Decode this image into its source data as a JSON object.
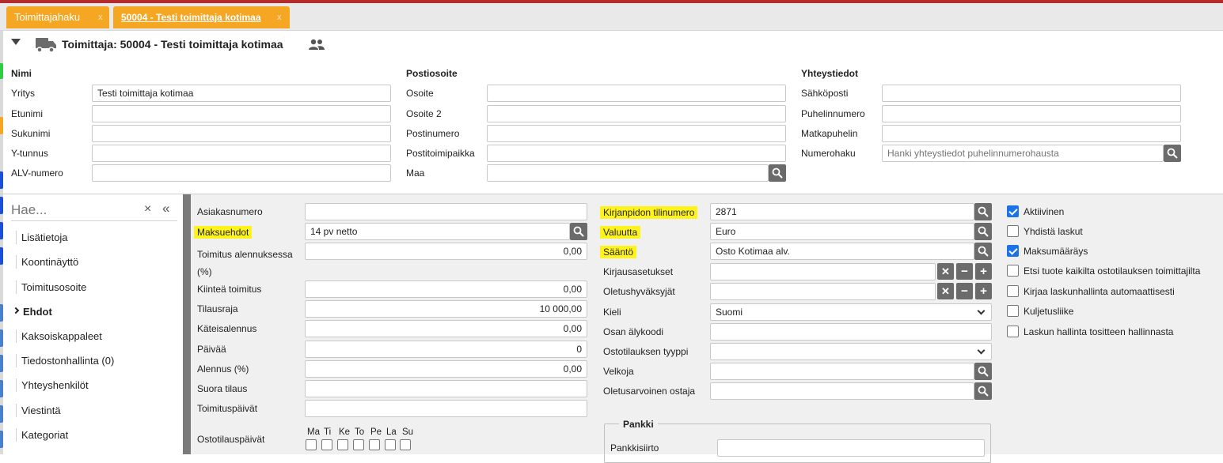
{
  "tabs": [
    {
      "label": "Toimittajahaku",
      "close": "x"
    },
    {
      "label": "50004 - Testi toimittaja kotimaa",
      "close": "x"
    }
  ],
  "header": {
    "title": "Toimittaja: 50004 - Testi toimittaja kotimaa",
    "icons": [
      "collapse-triangle-icon",
      "truck-icon",
      "people-icon"
    ]
  },
  "nimi": {
    "heading": "Nimi",
    "fields": [
      {
        "label": "Yritys",
        "value": "Testi toimittaja kotimaa"
      },
      {
        "label": "Etunimi",
        "value": ""
      },
      {
        "label": "Sukunimi",
        "value": ""
      },
      {
        "label": "Y-tunnus",
        "value": ""
      },
      {
        "label": "ALV-numero",
        "value": ""
      }
    ]
  },
  "postiosoite": {
    "heading": "Postiosoite",
    "fields": [
      {
        "label": "Osoite",
        "value": ""
      },
      {
        "label": "Osoite 2",
        "value": ""
      },
      {
        "label": "Postinumero",
        "value": ""
      },
      {
        "label": "Postitoimipaikka",
        "value": ""
      },
      {
        "label": "Maa",
        "value": ""
      }
    ]
  },
  "yhteystiedot": {
    "heading": "Yhteystiedot",
    "fields": [
      {
        "label": "Sähköposti",
        "value": ""
      },
      {
        "label": "Puhelinnumero",
        "value": ""
      },
      {
        "label": "Matkapuhelin",
        "value": ""
      },
      {
        "label": "Numerohaku",
        "value": "",
        "placeholder": "Hanki yhteystiedot puhelinnumerohausta"
      }
    ]
  },
  "sidebar": {
    "search_placeholder": "Hae...",
    "items": [
      {
        "label": "Lisätietoja"
      },
      {
        "label": "Koontinäyttö"
      },
      {
        "label": "Toimitusosoite"
      },
      {
        "label": "Ehdot",
        "active": true
      },
      {
        "label": "Kaksoiskappaleet"
      },
      {
        "label": "Tiedostonhallinta (0)"
      },
      {
        "label": "Yhteyshenkilöt"
      },
      {
        "label": "Viestintä"
      },
      {
        "label": "Kategoriat"
      }
    ]
  },
  "ehdot_left": [
    {
      "label": "Asiakasnumero",
      "value": ""
    },
    {
      "label": "Maksuehdot",
      "value": "14 pv netto",
      "highlight": true
    },
    {
      "label": "Toimitus alennuksessa (%)",
      "value": "0,00"
    },
    {
      "label": "Kiinteä toimitus",
      "value": "0,00"
    },
    {
      "label": "Tilausraja",
      "value": "10 000,00"
    },
    {
      "label": "Käteisalennus",
      "value": "0,00"
    },
    {
      "label": "Päivää",
      "value": "0"
    },
    {
      "label": "Alennus (%)",
      "value": "0,00"
    },
    {
      "label": "Suora tilaus",
      "value": ""
    },
    {
      "label": "Toimituspäivät",
      "value": ""
    }
  ],
  "ostotilauspaivat": {
    "label": "Ostotilauspäivät",
    "days": [
      "Ma",
      "Ti",
      "Ke",
      "To",
      "Pe",
      "La",
      "Su"
    ]
  },
  "ehdot_mid": [
    {
      "label": "Kirjanpidon tilinumero",
      "value": "2871",
      "highlight": true
    },
    {
      "label": "Valuutta",
      "value": "Euro",
      "highlight": true
    },
    {
      "label": "Sääntö",
      "value": "Osto Kotimaa alv.",
      "highlight": true
    },
    {
      "label": "Kirjausasetukset",
      "value": ""
    },
    {
      "label": "Oletushyväksyjät",
      "value": ""
    },
    {
      "label": "Kieli",
      "value": "Suomi"
    },
    {
      "label": "Osan älykoodi",
      "value": ""
    },
    {
      "label": "Ostotilauksen tyyppi",
      "value": ""
    },
    {
      "label": "Velkoja",
      "value": ""
    },
    {
      "label": "Oletusarvoinen ostaja",
      "value": ""
    }
  ],
  "pankki": {
    "heading": "Pankki",
    "fields": [
      {
        "label": "Pankkisiirto",
        "value": ""
      }
    ]
  },
  "checkboxes": [
    {
      "label": "Aktiivinen",
      "checked": true
    },
    {
      "label": "Yhdistä laskut",
      "checked": false
    },
    {
      "label": "Maksumääräys",
      "checked": true
    },
    {
      "label": "Etsi tuote kaikilta ostotilauksen toimittajilta",
      "checked": false
    },
    {
      "label": "Kirjaa laskunhallinta automaattisesti",
      "checked": false
    },
    {
      "label": "Kuljetusliike",
      "checked": false
    },
    {
      "label": "Laskun hallinta tositteen hallinnasta",
      "checked": false
    }
  ],
  "colors": {
    "tab": "#f5a623",
    "highlight": "#fff31c",
    "checkbox": "#1a73e8",
    "button": "#6b6b6b"
  }
}
